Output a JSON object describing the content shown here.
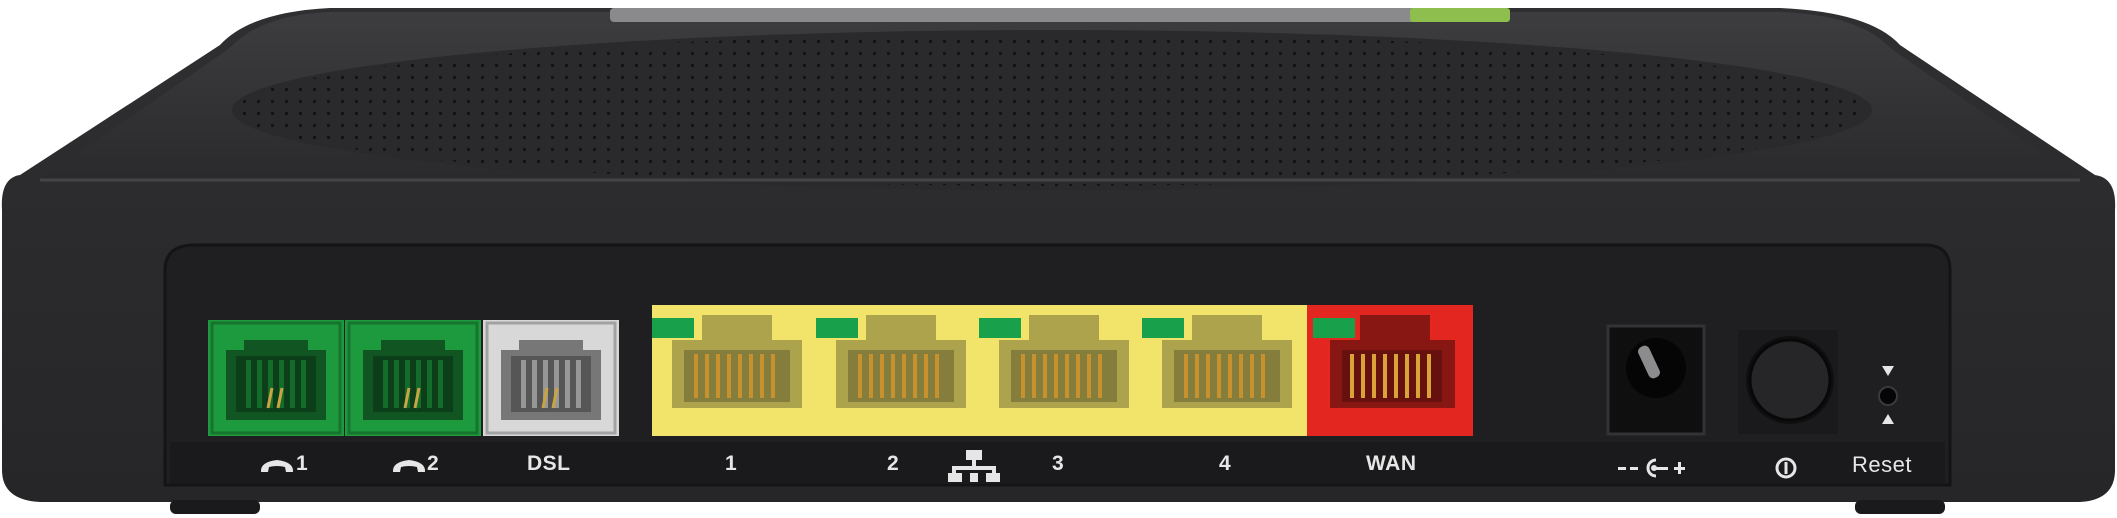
{
  "device": {
    "name": "router-rear-panel",
    "colors": {
      "body": "#2c2c2e",
      "body_top": "#3a3a3c",
      "panel": "#1d1d1f",
      "phone_port": "#1d9a3e",
      "dsl_port": "#d8d8d8",
      "lan_port": "#f2e36b",
      "wan_port": "#e3261f",
      "led": "#18a04a",
      "label_text": "#e6e6e6"
    }
  },
  "ports": [
    {
      "id": "phone1",
      "type": "phone",
      "label": "1",
      "icon": "phone-handset-icon"
    },
    {
      "id": "phone2",
      "type": "phone",
      "label": "2",
      "icon": "phone-handset-icon"
    },
    {
      "id": "dsl",
      "type": "dsl",
      "label": "DSL"
    },
    {
      "id": "lan1",
      "type": "lan",
      "label": "1"
    },
    {
      "id": "lan2",
      "type": "lan",
      "label": "2"
    },
    {
      "id": "lan3",
      "type": "lan",
      "label": "3"
    },
    {
      "id": "lan4",
      "type": "lan",
      "label": "4"
    },
    {
      "id": "wan",
      "type": "wan",
      "label": "WAN"
    },
    {
      "id": "power_in",
      "type": "dc-jack",
      "label": "--◉+",
      "icon": "dc-polarity-icon"
    },
    {
      "id": "power_button",
      "type": "button",
      "icon": "power-icon"
    },
    {
      "id": "reset",
      "type": "pinhole",
      "label": "Reset",
      "icon": "reset-arrows-icon"
    }
  ],
  "lan_group_icon": "network-icon"
}
